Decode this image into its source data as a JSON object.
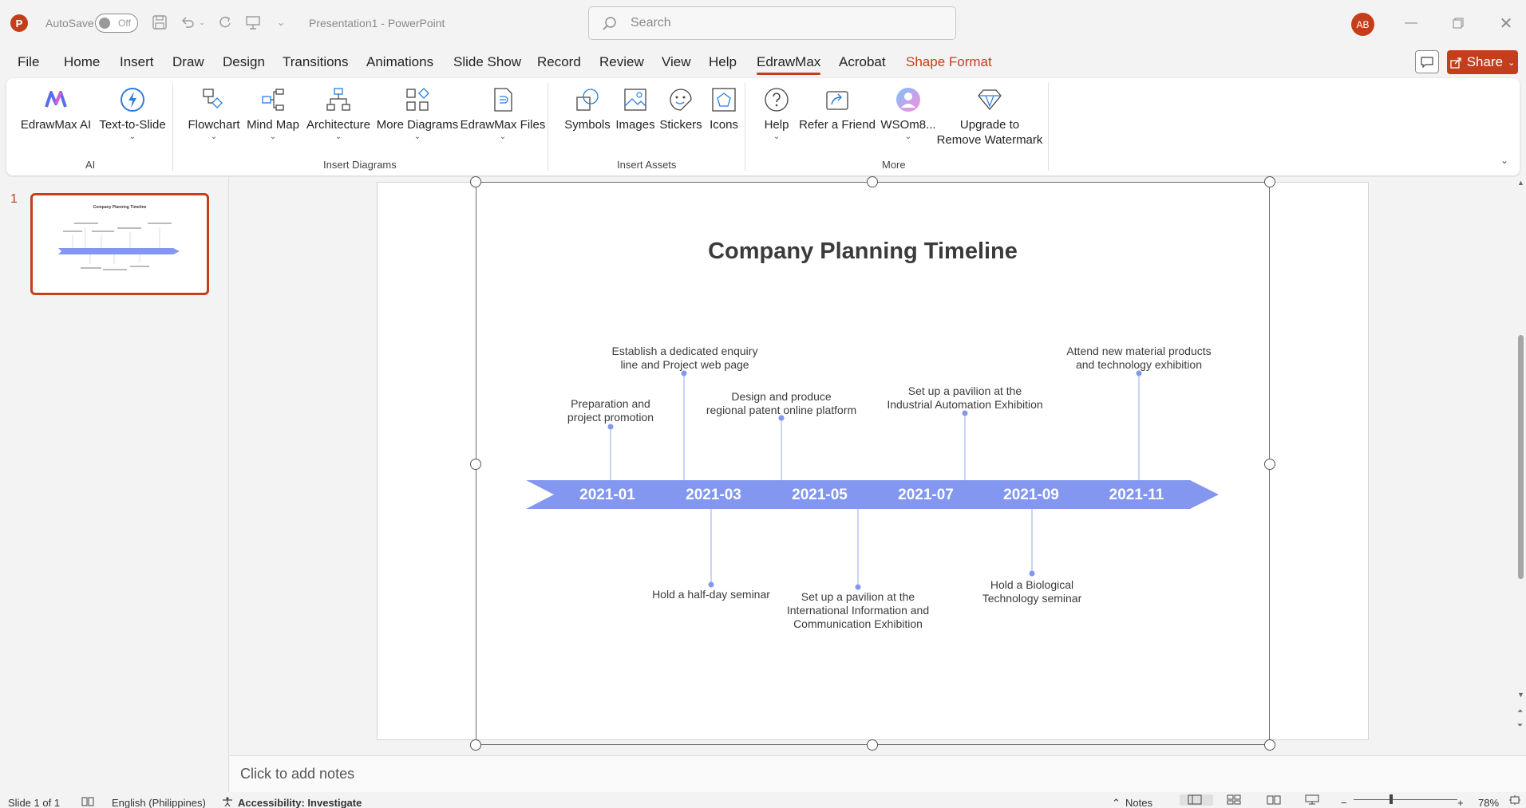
{
  "titlebar": {
    "app_letter": "P",
    "autosave_label": "AutoSave",
    "autosave_state": "Off",
    "document_title": "Presentation1 - PowerPoint",
    "search_placeholder": "Search",
    "avatar_initials": "AB"
  },
  "menu": {
    "tabs": [
      "File",
      "Home",
      "Insert",
      "Draw",
      "Design",
      "Transitions",
      "Animations",
      "Slide Show",
      "Record",
      "Review",
      "View",
      "Help",
      "EdrawMax",
      "Acrobat",
      "Shape Format"
    ],
    "active_tab": "EdrawMax",
    "share_label": "Share"
  },
  "ribbon": {
    "groups": [
      {
        "label": "AI",
        "buttons": [
          {
            "label": "EdrawMax AI",
            "icon": "edrawmax-ai-icon"
          },
          {
            "label": "Text-to-Slide",
            "icon": "lightning-icon"
          }
        ]
      },
      {
        "label": "Insert Diagrams",
        "buttons": [
          {
            "label": "Flowchart",
            "icon": "flowchart-icon"
          },
          {
            "label": "Mind Map",
            "icon": "mind-map-icon"
          },
          {
            "label": "Architecture",
            "icon": "architecture-icon"
          },
          {
            "label": "More Diagrams",
            "icon": "more-diagrams-icon"
          },
          {
            "label": "EdrawMax Files",
            "icon": "edrawmax-files-icon"
          }
        ]
      },
      {
        "label": "Insert Assets",
        "buttons": [
          {
            "label": "Symbols",
            "icon": "symbols-icon"
          },
          {
            "label": "Images",
            "icon": "images-icon"
          },
          {
            "label": "Stickers",
            "icon": "stickers-icon"
          },
          {
            "label": "Icons",
            "icon": "pentagon-icon"
          }
        ]
      },
      {
        "label": "More",
        "buttons": [
          {
            "label": "Help",
            "icon": "help-icon"
          },
          {
            "label": "Refer a Friend",
            "icon": "share-icon"
          },
          {
            "label": "WSOm8...",
            "icon": "profile-icon"
          },
          {
            "label": "Upgrade to",
            "label2": "Remove Watermark",
            "icon": "diamond-icon"
          }
        ]
      }
    ]
  },
  "thumbnails": {
    "slide_number": "1"
  },
  "slide": {
    "title": "Company Planning Timeline",
    "dates": [
      "2021-01",
      "2021-03",
      "2021-05",
      "2021-07",
      "2021-09",
      "2021-11"
    ],
    "events_above": [
      {
        "line1": "Preparation and",
        "line2": "project promotion"
      },
      {
        "line1": "Establish a dedicated enquiry",
        "line2": "line and Project web page"
      },
      {
        "line1": "Design and produce",
        "line2": "regional patent online platform"
      },
      {
        "line1": "Set up a pavilion at the",
        "line2": "Industrial Automation Exhibition"
      },
      {
        "line1": "Attend new material products",
        "line2": "and technology exhibition"
      }
    ],
    "events_below": [
      {
        "line1": "Hold a half-day seminar"
      },
      {
        "line1": "Set up a pavilion at the",
        "line2": "International Information and",
        "line3": "Communication Exhibition"
      },
      {
        "line1": "Hold a Biological",
        "line2": "Technology seminar"
      }
    ],
    "arrow_color": "#8397f0",
    "connector_color": "#b9c4f6"
  },
  "notes": {
    "placeholder": "Click to add notes"
  },
  "statusbar": {
    "slide_info": "Slide 1 of 1",
    "language": "English (Philippines)",
    "accessibility": "Accessibility: Investigate",
    "notes_label": "Notes",
    "zoom": "78%"
  }
}
